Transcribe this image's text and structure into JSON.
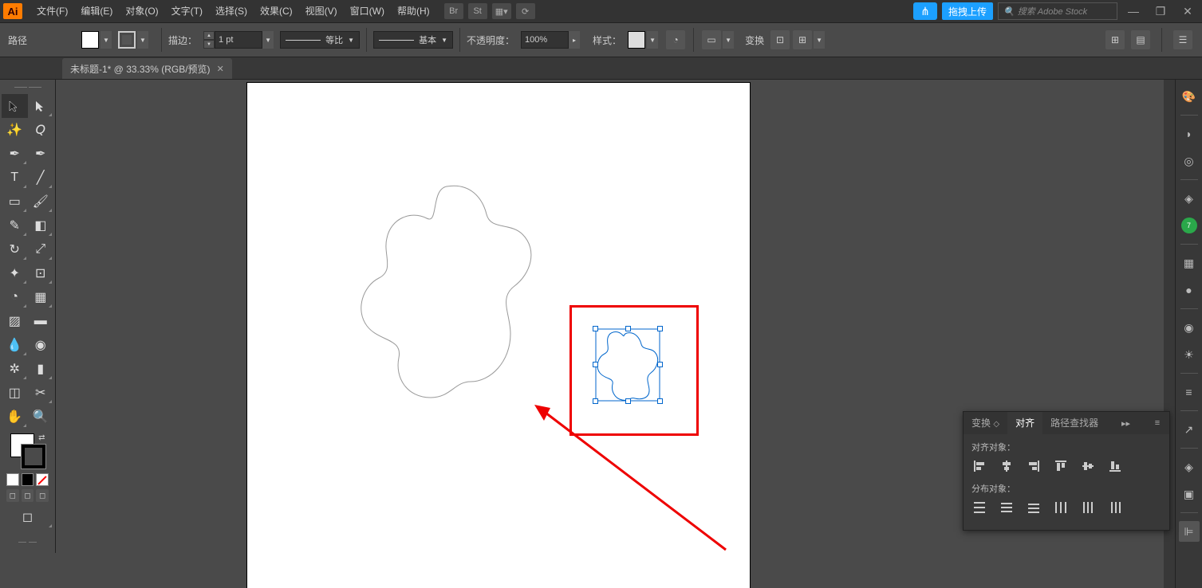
{
  "app": {
    "logo": "Ai"
  },
  "menu": {
    "file": "文件(F)",
    "edit": "编辑(E)",
    "object": "对象(O)",
    "type": "文字(T)",
    "select": "选择(S)",
    "effect": "效果(C)",
    "view": "视图(V)",
    "window": "窗口(W)",
    "help": "帮助(H)"
  },
  "top_right": {
    "drag_upload": "拖拽上传",
    "search_placeholder": "搜索 Adobe Stock"
  },
  "control": {
    "mode": "路径",
    "stroke_label": "描边：",
    "stroke_weight": "1 pt",
    "brush_profile": "等比",
    "brush_def": "基本",
    "opacity_label": "不透明度：",
    "opacity_value": "100%",
    "style_label": "样式：",
    "transform_label": "变换"
  },
  "tab": {
    "title": "未标题-1* @ 33.33% (RGB/预览)"
  },
  "align_panel": {
    "tab_transform": "变换",
    "tab_align": "对齐",
    "tab_pathfinder": "路径查找器",
    "align_objects_label": "对齐对象：",
    "distribute_objects_label": "分布对象："
  }
}
